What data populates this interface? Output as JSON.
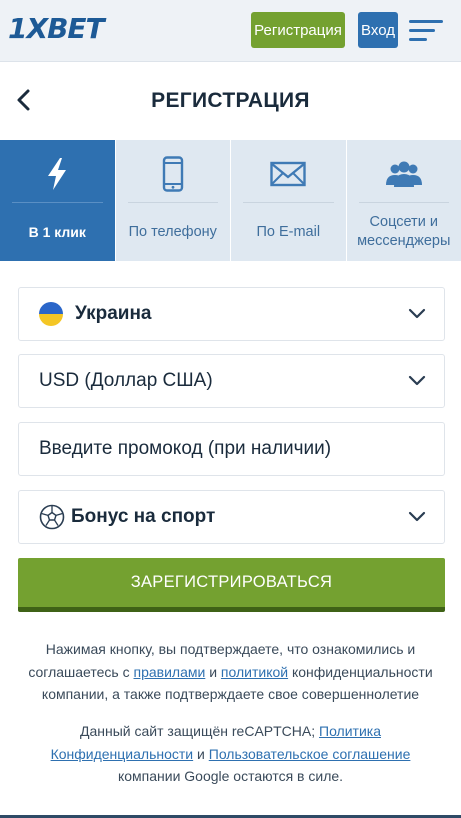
{
  "header": {
    "logo": "1XBET",
    "register_label": "Регистрация",
    "login_label": "Вход"
  },
  "title": "РЕГИСТРАЦИЯ",
  "tabs": [
    {
      "label": "В 1 клик",
      "icon": "lightning-icon",
      "active": true
    },
    {
      "label": "По телефону",
      "icon": "phone-icon",
      "active": false
    },
    {
      "label": "По E-mail",
      "icon": "envelope-icon",
      "active": false
    },
    {
      "label": "Соцсети и мессенджеры",
      "icon": "users-icon",
      "active": false
    }
  ],
  "form": {
    "country": "Украина",
    "currency": "USD (Доллар США)",
    "promo_placeholder": "Введите промокод (при наличии)",
    "bonus": "Бонус на спорт",
    "submit_label": "ЗАРЕГИСТРИРОВАТЬСЯ"
  },
  "consent": {
    "part1": "Нажимая кнопку, вы подтверждаете, что ознакомились и соглашаетесь с ",
    "rules_link": "правилами",
    "and1": " и ",
    "policy_link": "политикой",
    "part2": " конфиденциальности компании, а также подтверждаете свое совершеннолетие"
  },
  "recaptcha": {
    "part1": "Данный сайт защищён reCAPTCHA; ",
    "privacy_link": "Политика Конфиденциальности",
    "and": " и ",
    "terms_link": "Пользовательское соглашение",
    "part2": " компании Google остаются в силе."
  },
  "colors": {
    "brand_blue": "#2e70b0",
    "accent_green": "#74a130",
    "tab_bg": "#dfe8f1"
  }
}
